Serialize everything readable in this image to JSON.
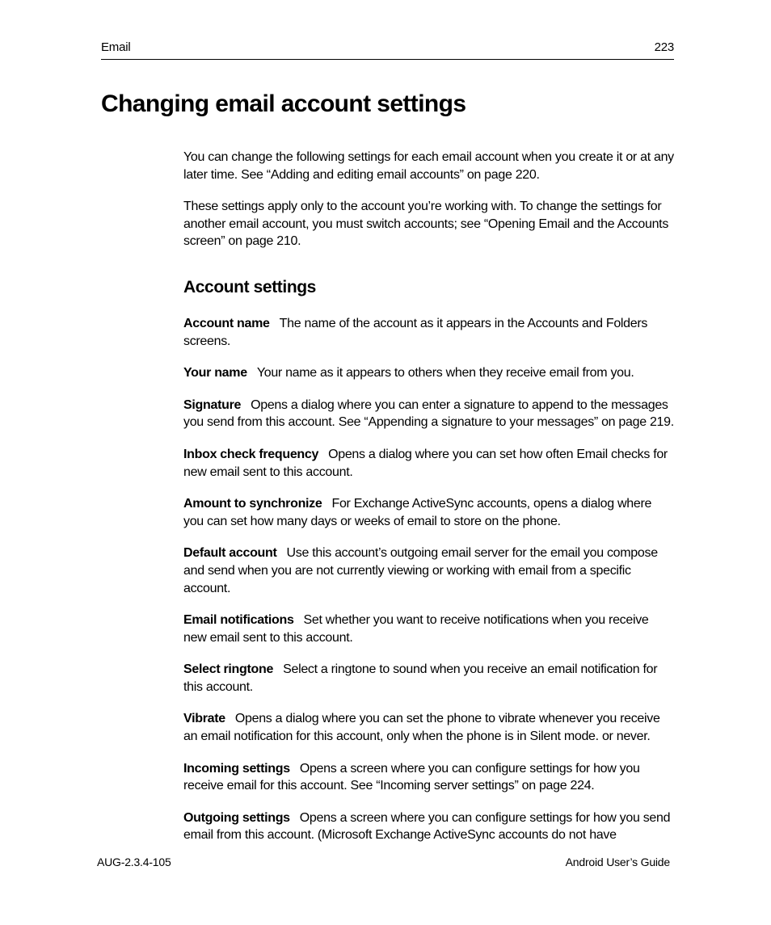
{
  "header": {
    "section": "Email",
    "page_number": "223"
  },
  "title": "Changing email account settings",
  "intro": [
    "You can change the following settings for each email account when you create it or at any later time. See “Adding and editing email accounts” on page 220.",
    "These settings apply only to the account you’re working with. To change the settings for another email account, you must switch accounts; see “Opening Email and the Accounts screen” on page 210."
  ],
  "section_heading": "Account settings",
  "settings": [
    {
      "label": "Account name",
      "desc": "The name of the account as it appears in the Accounts and Folders screens."
    },
    {
      "label": "Your name",
      "desc": "Your name as it appears to others when they receive email from you."
    },
    {
      "label": "Signature",
      "desc": "Opens a dialog where you can enter a signature to append to the messages you send from this account. See “Appending a signature to your messages” on page 219."
    },
    {
      "label": "Inbox check frequency",
      "desc": "Opens a dialog where you can set how often Email checks for new email sent to this account."
    },
    {
      "label": "Amount to synchronize",
      "desc": "For Exchange ActiveSync accounts, opens a dialog where you can set how many days or weeks of email to store on the phone."
    },
    {
      "label": "Default account",
      "desc": "Use this account’s outgoing email server for the email you compose and send when you are not currently viewing or working with email from a specific account."
    },
    {
      "label": "Email notifications",
      "desc": "Set whether you want to receive notifications when you receive new email sent to this account."
    },
    {
      "label": "Select ringtone",
      "desc": "Select a ringtone to sound when you receive an email notification for this account."
    },
    {
      "label": "Vibrate",
      "desc": "Opens a dialog where you can set the phone to vibrate whenever you receive an email notification for this account, only when the phone is in Silent mode. or never."
    },
    {
      "label": "Incoming settings",
      "desc": "Opens a screen where you can configure settings for how you receive email for this account. See “Incoming server settings” on page 224."
    },
    {
      "label": "Outgoing settings",
      "desc": "Opens a screen where you can configure settings for how you send email from this account. (Microsoft Exchange ActiveSync accounts do not have"
    }
  ],
  "footer": {
    "left": "AUG-2.3.4-105",
    "right": "Android User’s Guide"
  }
}
